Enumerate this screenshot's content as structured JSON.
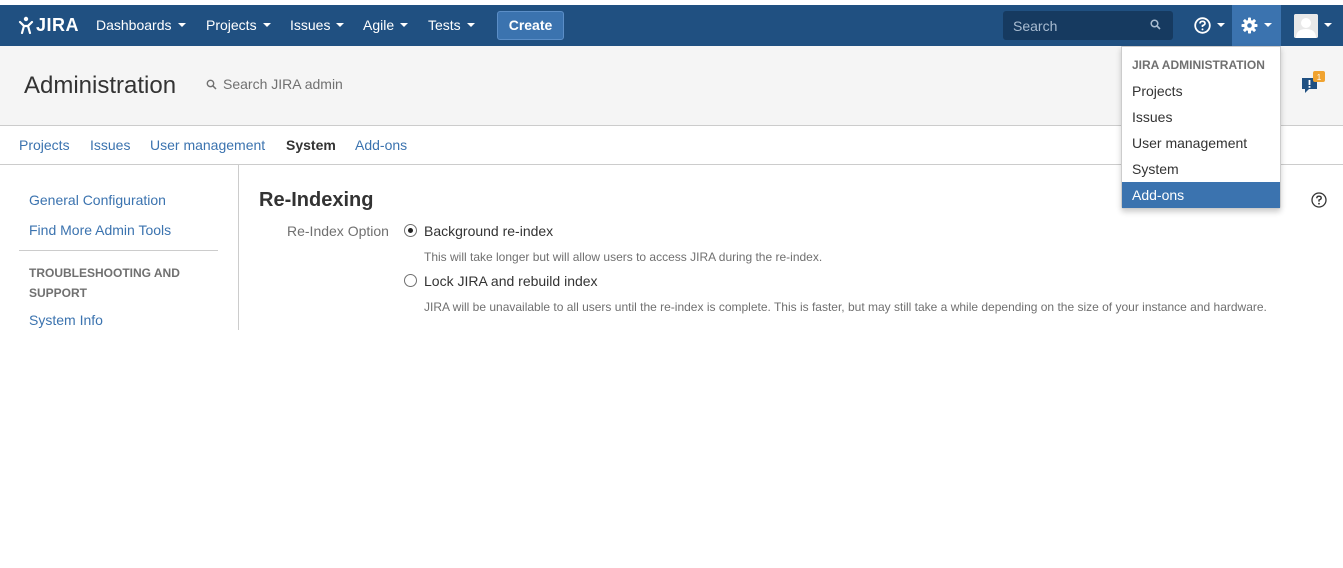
{
  "topbar": {
    "logo": "JIRA",
    "nav": [
      {
        "label": "Dashboards"
      },
      {
        "label": "Projects"
      },
      {
        "label": "Issues"
      },
      {
        "label": "Agile"
      },
      {
        "label": "Tests"
      }
    ],
    "create_label": "Create",
    "search_placeholder": "Search",
    "icons": {
      "search": "search-icon",
      "help": "help-icon",
      "settings": "gear-icon",
      "user": "avatar-icon"
    }
  },
  "admin_header": {
    "title": "Administration",
    "search_label": "Search JIRA admin",
    "notification_count": "1"
  },
  "tabs": [
    {
      "label": "Projects"
    },
    {
      "label": "Issues"
    },
    {
      "label": "User management"
    },
    {
      "label": "System",
      "active": true
    },
    {
      "label": "Add-ons"
    }
  ],
  "sidebar": {
    "links": [
      {
        "label": "General Configuration"
      },
      {
        "label": "Find More Admin Tools"
      }
    ],
    "section_heading": "TROUBLESHOOTING AND SUPPORT",
    "section_links": [
      {
        "label": "System Info"
      }
    ]
  },
  "content": {
    "title": "Re-Indexing",
    "field_label": "Re-Index Option",
    "options": [
      {
        "label": "Background re-index",
        "checked": true,
        "description": "This will take longer but will allow users to access JIRA during the re-index."
      },
      {
        "label": "Lock JIRA and rebuild index",
        "checked": false,
        "description": "JIRA will be unavailable to all users until the re-index is complete. This is faster, but may still take a while depending on the size of your instance and hardware."
      }
    ]
  },
  "admin_menu": {
    "heading": "JIRA ADMINISTRATION",
    "items": [
      {
        "label": "Projects"
      },
      {
        "label": "Issues"
      },
      {
        "label": "User management"
      },
      {
        "label": "System"
      },
      {
        "label": "Add-ons",
        "highlighted": true
      }
    ]
  },
  "colors": {
    "topbar": "#205081",
    "accent": "#3b73af",
    "link": "#3b73af",
    "badge": "#f0a330"
  }
}
